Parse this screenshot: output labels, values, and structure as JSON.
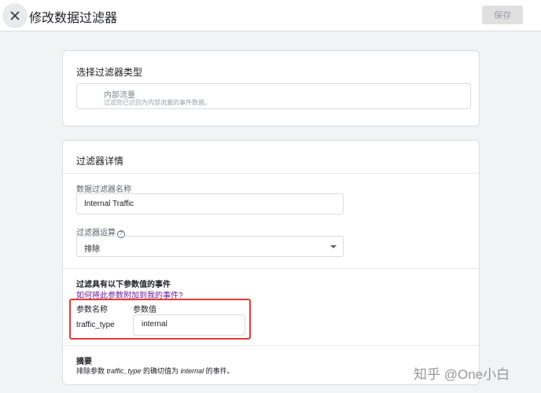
{
  "header": {
    "title": "修改数据过滤器",
    "save_label": "保存"
  },
  "filter_type": {
    "heading": "选择过滤器类型",
    "selected_name": "内部流量",
    "selected_description": "过滤您已识别为内部流量的事件数据。"
  },
  "details": {
    "heading": "过滤器详情",
    "name_label": "数据过滤器名称",
    "name_value": "Internal Traffic",
    "operation_label": "过滤器运算",
    "operation_value": "排除",
    "params_heading": "过滤具有以下参数值的事件",
    "params_help_link": "如何将此参数附加到我的事件?",
    "param_name_header": "参数名称",
    "param_value_header": "参数值",
    "param_name": "traffic_type",
    "param_value": "internal",
    "summary_heading": "摘要",
    "summary_prefix": "排除参数 ",
    "summary_param": "traffic_type",
    "summary_middle": " 的确切值为 ",
    "summary_value": "internal",
    "summary_suffix": " 的事件。"
  },
  "watermark": "知乎 @One小白",
  "colors": {
    "highlight": "#e53935",
    "link": "#6a1b9a"
  }
}
